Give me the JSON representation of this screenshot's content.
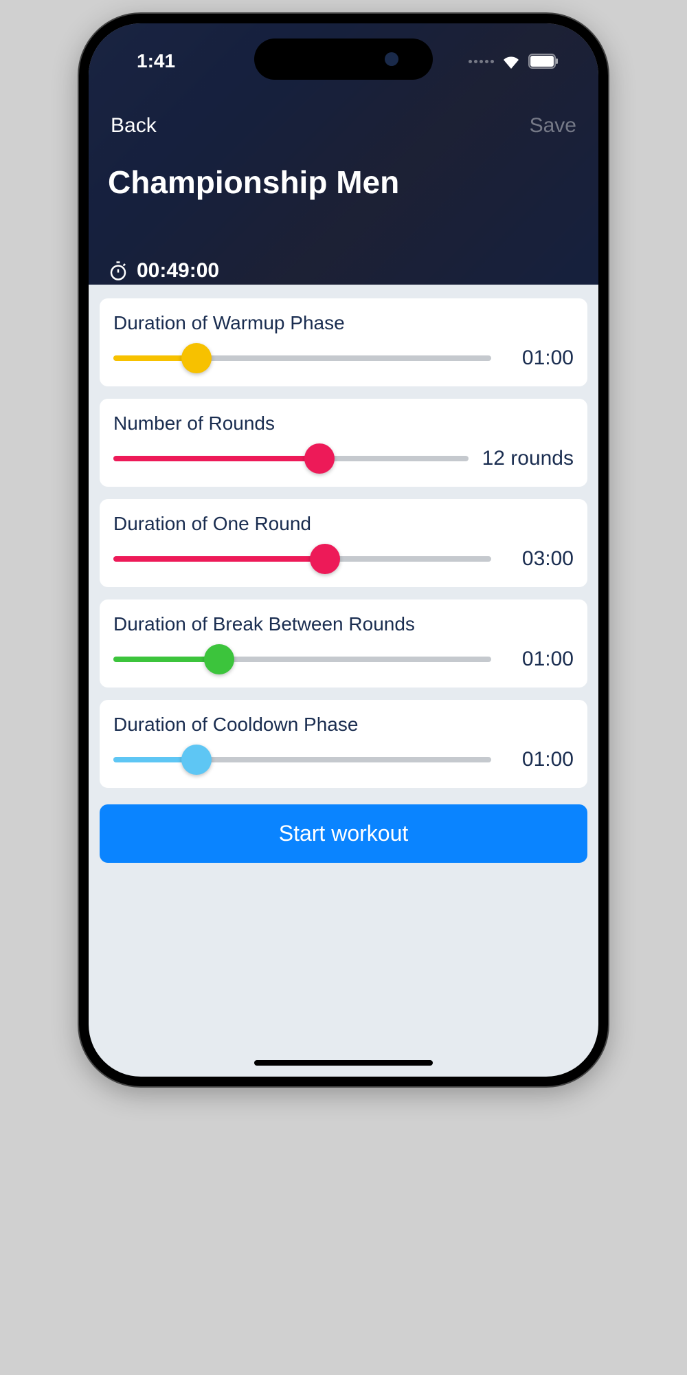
{
  "status_bar": {
    "time": "1:41"
  },
  "nav": {
    "back_label": "Back",
    "save_label": "Save"
  },
  "page_title": "Championship Men",
  "total_time": "00:49:00",
  "settings": [
    {
      "label": "Duration of Warmup Phase",
      "value": "01:00",
      "fill_pct": 22,
      "color": "#f7c100"
    },
    {
      "label": "Number of Rounds",
      "value": "12 rounds",
      "fill_pct": 58,
      "color": "#ed1a58"
    },
    {
      "label": "Duration of One Round",
      "value": "03:00",
      "fill_pct": 56,
      "color": "#ed1a58"
    },
    {
      "label": "Duration of Break Between Rounds",
      "value": "01:00",
      "fill_pct": 28,
      "color": "#3cc43c"
    },
    {
      "label": "Duration of Cooldown Phase",
      "value": "01:00",
      "fill_pct": 22,
      "color": "#5ec6f4"
    }
  ],
  "start_button_label": "Start workout"
}
